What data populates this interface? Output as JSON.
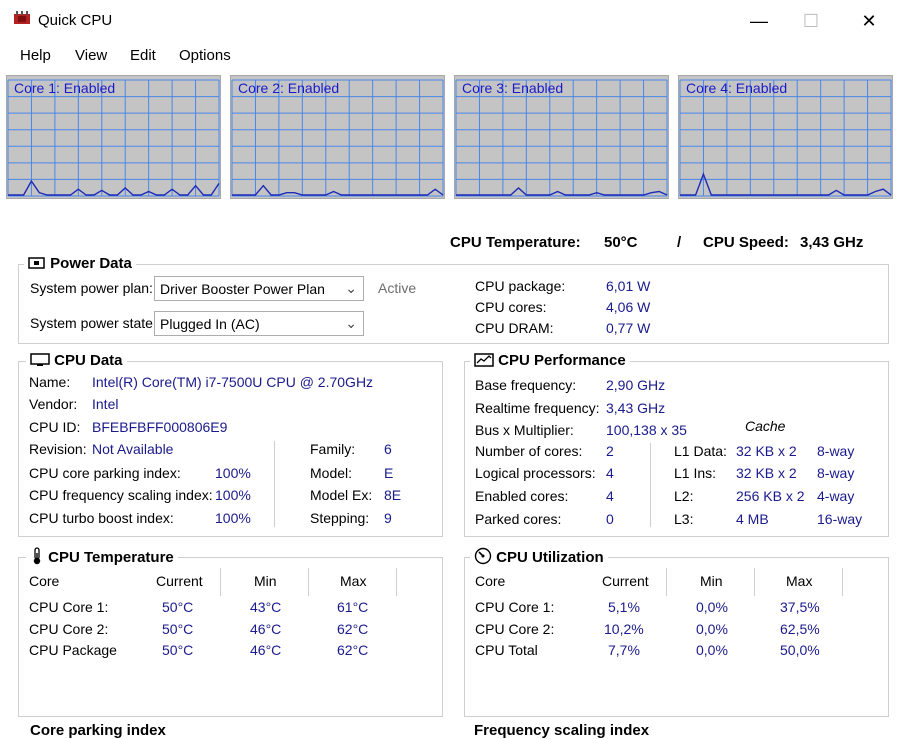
{
  "window": {
    "title": "Quick CPU",
    "minimize": "—",
    "maximize": "☐",
    "close": "✕"
  },
  "menu": [
    "Help",
    "View",
    "Edit",
    "Options"
  ],
  "core_graphs": [
    {
      "label": "Core 1: Enabled",
      "trace": [
        0,
        0,
        0,
        0.12,
        0.02,
        0,
        0,
        0,
        0,
        0.05,
        0,
        0,
        0.04,
        0,
        0,
        0.06,
        0,
        0,
        0.03,
        0,
        0,
        0.05,
        0,
        0,
        0.08,
        0,
        0,
        0.1
      ]
    },
    {
      "label": "Core 2: Enabled",
      "trace": [
        0,
        0,
        0,
        0,
        0.08,
        0,
        0,
        0.02,
        0.02,
        0,
        0,
        0,
        0,
        0.03,
        0,
        0,
        0,
        0,
        0,
        0,
        0,
        0,
        0,
        0,
        0,
        0,
        0.05,
        0
      ]
    },
    {
      "label": "Core 3: Enabled",
      "trace": [
        0,
        0,
        0,
        0,
        0,
        0,
        0,
        0,
        0.06,
        0,
        0,
        0,
        0,
        0.03,
        0,
        0,
        0,
        0,
        0.02,
        0,
        0,
        0,
        0,
        0,
        0,
        0.02,
        0.03,
        0
      ]
    },
    {
      "label": "Core 4: Enabled",
      "trace": [
        0,
        0,
        0,
        0.18,
        0,
        0,
        0,
        0,
        0,
        0,
        0,
        0,
        0,
        0,
        0,
        0,
        0,
        0,
        0,
        0,
        0.04,
        0,
        0,
        0,
        0,
        0.03,
        0.05,
        0
      ]
    }
  ],
  "header": {
    "temp_label": "CPU Temperature:",
    "temp_value": "50°C",
    "slash": "/",
    "speed_label": "CPU Speed:",
    "speed_value": "3,43 GHz"
  },
  "power": {
    "title": "Power Data",
    "plan_label": "System power plan:",
    "plan_value": "Driver Booster Power Plan",
    "plan_status": "Active",
    "state_label": "System power state:",
    "state_value": "Plugged In (AC)",
    "package_label": "CPU package:",
    "package_value": "6,01 W",
    "cores_label": "CPU cores:",
    "cores_value": "4,06 W",
    "dram_label": "CPU DRAM:",
    "dram_value": "0,77 W"
  },
  "cpu_data": {
    "title": "CPU Data",
    "name_label": "Name:",
    "name_value": "Intel(R) Core(TM) i7-7500U CPU @ 2.70GHz",
    "vendor_label": "Vendor:",
    "vendor_value": "Intel",
    "id_label": "CPU ID:",
    "id_value": "BFEBFBFF000806E9",
    "revision_label": "Revision:",
    "revision_value": "Not Available",
    "parking_label": "CPU core parking index:",
    "parking_value": "100%",
    "freq_label": "CPU frequency scaling index:",
    "freq_value": "100%",
    "turbo_label": "CPU turbo boost index:",
    "turbo_value": "100%",
    "family_label": "Family:",
    "family_value": "6",
    "model_label": "Model:",
    "model_value": "E",
    "modelex_label": "Model Ex:",
    "modelex_value": "8E",
    "stepping_label": "Stepping:",
    "stepping_value": "9"
  },
  "cpu_perf": {
    "title": "CPU Performance",
    "base_label": "Base frequency:",
    "base_value": "2,90 GHz",
    "real_label": "Realtime frequency:",
    "real_value": "3,43 GHz",
    "bus_label": "Bus x Multiplier:",
    "bus_value": "100,138 x 35",
    "cores_label": "Number of cores:",
    "cores_value": "2",
    "logical_label": "Logical processors:",
    "logical_value": "4",
    "enabled_label": "Enabled cores:",
    "enabled_value": "4",
    "parked_label": "Parked cores:",
    "parked_value": "0",
    "cache_title": "Cache",
    "cache": [
      {
        "level": "L1 Data:",
        "size": "32 KB x 2",
        "assoc": "8-way"
      },
      {
        "level": "L1 Ins:",
        "size": "32 KB x 2",
        "assoc": "8-way"
      },
      {
        "level": "L2:",
        "size": "256 KB x 2",
        "assoc": "4-way"
      },
      {
        "level": "L3:",
        "size": "4 MB",
        "assoc": "16-way"
      }
    ]
  },
  "cpu_temp": {
    "title": "CPU Temperature",
    "columns": [
      "Core",
      "Current",
      "Min",
      "Max"
    ],
    "rows": [
      [
        "CPU Core 1:",
        "50°C",
        "43°C",
        "61°C"
      ],
      [
        "CPU Core 2:",
        "50°C",
        "46°C",
        "62°C"
      ],
      [
        "CPU Package",
        "50°C",
        "46°C",
        "62°C"
      ]
    ]
  },
  "cpu_util": {
    "title": "CPU Utilization",
    "columns": [
      "Core",
      "Current",
      "Min",
      "Max"
    ],
    "rows": [
      [
        "CPU Core 1:",
        "5,1%",
        "0,0%",
        "37,5%"
      ],
      [
        "CPU Core 2:",
        "10,2%",
        "0,0%",
        "62,5%"
      ],
      [
        "CPU Total",
        "7,7%",
        "0,0%",
        "50,0%"
      ]
    ]
  },
  "bottom": {
    "left_title": "Core parking index",
    "right_title": "Frequency scaling index"
  },
  "colors": {
    "graph_bg": "#c4c4c4",
    "grid": "#4a86e8",
    "trace": "#1d2bb8",
    "value_text": "#1a1a8c"
  }
}
